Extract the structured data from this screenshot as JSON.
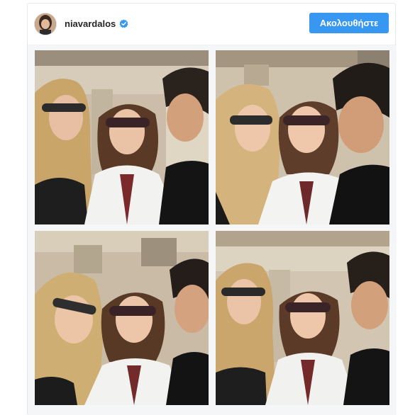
{
  "post": {
    "username": "niavardalos",
    "verified": true,
    "follow_label": "Ακολουθήστε"
  },
  "colors": {
    "follow_button": "#3897f0",
    "verified_badge": "#3897f0",
    "username_text": "#262626"
  },
  "icons": {
    "verified": "verified-badge-icon"
  }
}
